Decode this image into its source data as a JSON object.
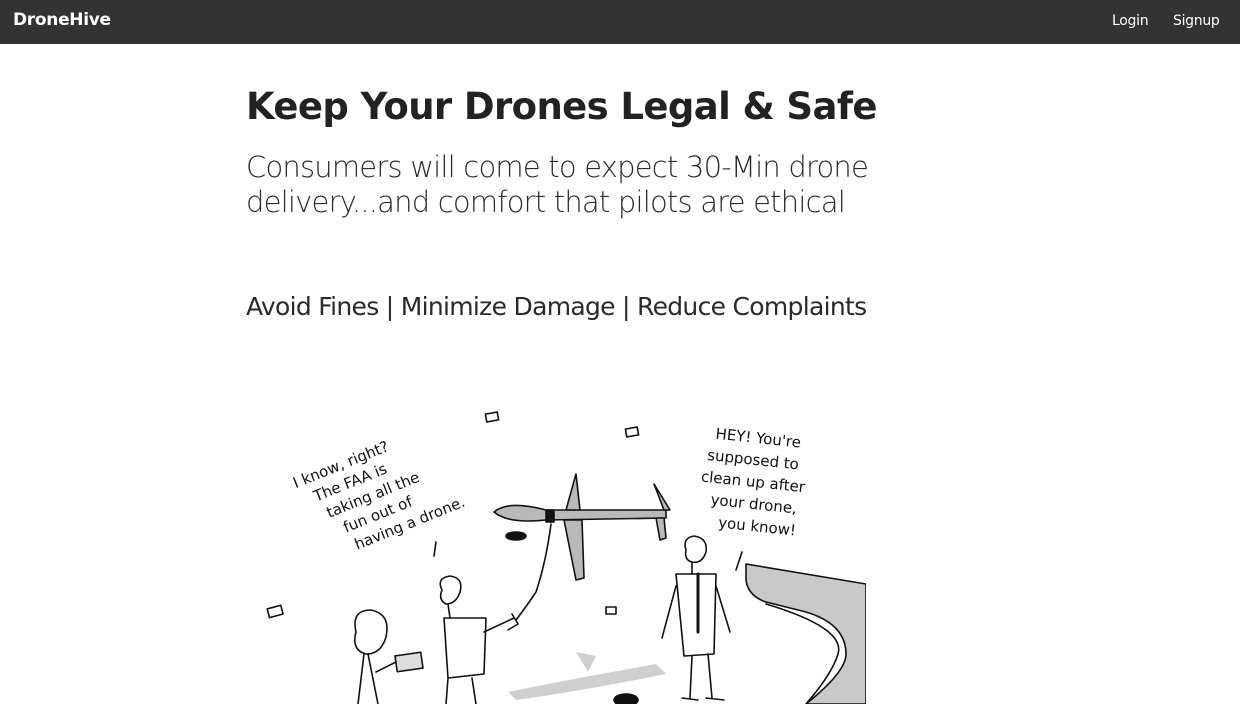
{
  "navbar": {
    "brand": "DroneHive",
    "login_label": "Login",
    "signup_label": "Signup"
  },
  "hero": {
    "headline": "Keep Your Drones Legal & Safe",
    "subhead": "Consumers will come to expect 30-Min drone delivery...and comfort that pilots are ethical",
    "benefits": "Avoid Fines | Minimize Damage | Reduce Complaints"
  },
  "cartoon": {
    "left_speech": [
      "I know, right?",
      "The FAA is",
      "taking all the",
      "fun out of",
      "having a drone."
    ],
    "right_speech": [
      "HEY! You're",
      "supposed to",
      "clean up after",
      "your drone,",
      "you know!"
    ]
  }
}
